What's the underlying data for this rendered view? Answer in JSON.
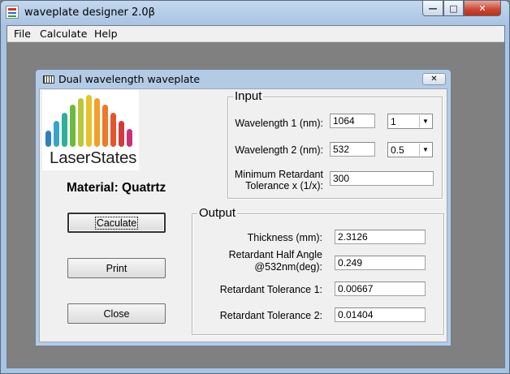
{
  "window": {
    "title": "waveplate designer 2.0β",
    "minimize_glyph": "—",
    "maximize_glyph": "□",
    "close_glyph": "✕"
  },
  "menubar": {
    "file": "File",
    "calculate": "Calculate",
    "help": "Help"
  },
  "dialog": {
    "title": "Dual wavelength waveplate",
    "close_glyph": "✕",
    "logo_text": "LaserStates",
    "material": "Material: Quatrtz",
    "buttons": {
      "calculate": "Caculate",
      "print": "Print",
      "close": "Close"
    },
    "input": {
      "group_label": "Input",
      "wavelength1_label": "Wavelength 1 (nm):",
      "wavelength1_value": "1064",
      "wavelength1_order": "1",
      "wavelength2_label": "Wavelength 2 (nm):",
      "wavelength2_value": "532",
      "wavelength2_order": "0.5",
      "tolerance_label_line1": "Minimum Retardant",
      "tolerance_label_line2": "Tolerance x (1/x):",
      "tolerance_value": "300"
    },
    "output": {
      "group_label": "Output",
      "thickness_label": "Thickness (mm):",
      "thickness_value": "2.3126",
      "half_angle_label_line1": "Retardant Half Angle",
      "half_angle_label_line2": "@532nm(deg):",
      "half_angle_value": "0.249",
      "tol1_label": "Retardant Tolerance 1:",
      "tol1_value": "0.00667",
      "tol2_label": "Retardant Tolerance 2:",
      "tol2_value": "0.01404"
    }
  },
  "colors": {
    "logo_bars": [
      "#2e7fc2",
      "#3aa4c8",
      "#2fae9a",
      "#6cbb3c",
      "#b7c93a",
      "#e8c22a",
      "#f0a02b",
      "#ec7a2a",
      "#e5552d",
      "#d43a3a",
      "#c7327a"
    ]
  },
  "icons": {
    "dropdown": "chevron-down-icon",
    "app": "app-icon",
    "dialog": "dialog-icon"
  }
}
